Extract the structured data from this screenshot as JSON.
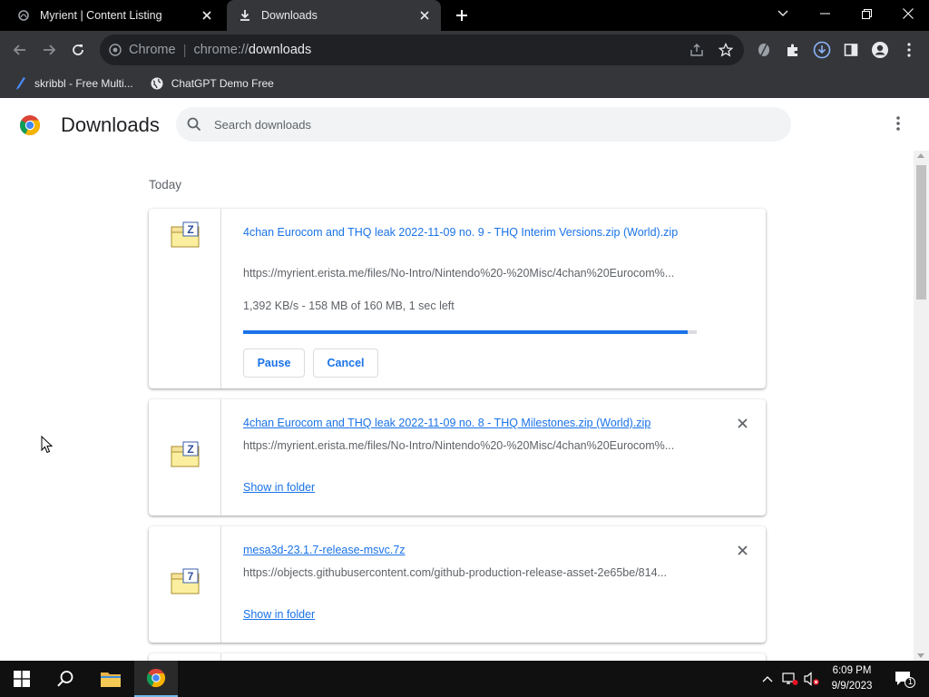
{
  "tabs": [
    {
      "title": "Myrient | Content Listing",
      "active": false,
      "icon": "myrient-favicon"
    },
    {
      "title": "Downloads",
      "active": true,
      "icon": "download-icon"
    }
  ],
  "omnibox": {
    "chip": "Chrome",
    "scheme": "chrome://",
    "host": "downloads"
  },
  "bookmarks": [
    {
      "label": "skribbl - Free Multi...",
      "icon": "skribbl-icon"
    },
    {
      "label": "ChatGPT Demo Free",
      "icon": "globe-icon"
    }
  ],
  "downloads_page": {
    "title": "Downloads",
    "search_placeholder": "Search downloads",
    "date_group": "Today",
    "items": [
      {
        "filename": "4chan Eurocom and THQ leak 2022-11-09 no. 9 - THQ Interim Versions.zip (World).zip",
        "url": "https://myrient.erista.me/files/No-Intro/Nintendo%20-%20Misc/4chan%20Eurocom%...",
        "status": "1,392 KB/s - 158 MB of 160 MB, 1 sec left",
        "progress": 0.98,
        "pause_label": "Pause",
        "cancel_label": "Cancel"
      },
      {
        "filename": "4chan Eurocom and THQ leak 2022-11-09 no. 8 - THQ Milestones.zip (World).zip",
        "url": "https://myrient.erista.me/files/No-Intro/Nintendo%20-%20Misc/4chan%20Eurocom%...",
        "action": "Show in folder"
      },
      {
        "filename": "mesa3d-23.1.7-release-msvc.7z",
        "url": "https://objects.githubusercontent.com/github-production-release-asset-2e65be/814...",
        "action": "Show in folder"
      }
    ]
  },
  "taskbar": {
    "time": "6:09 PM",
    "date": "9/9/2023",
    "notification_count": "1"
  },
  "colors": {
    "accent": "#1a73e8",
    "tab_bg": "#35363a",
    "titlebar": "#000000"
  }
}
